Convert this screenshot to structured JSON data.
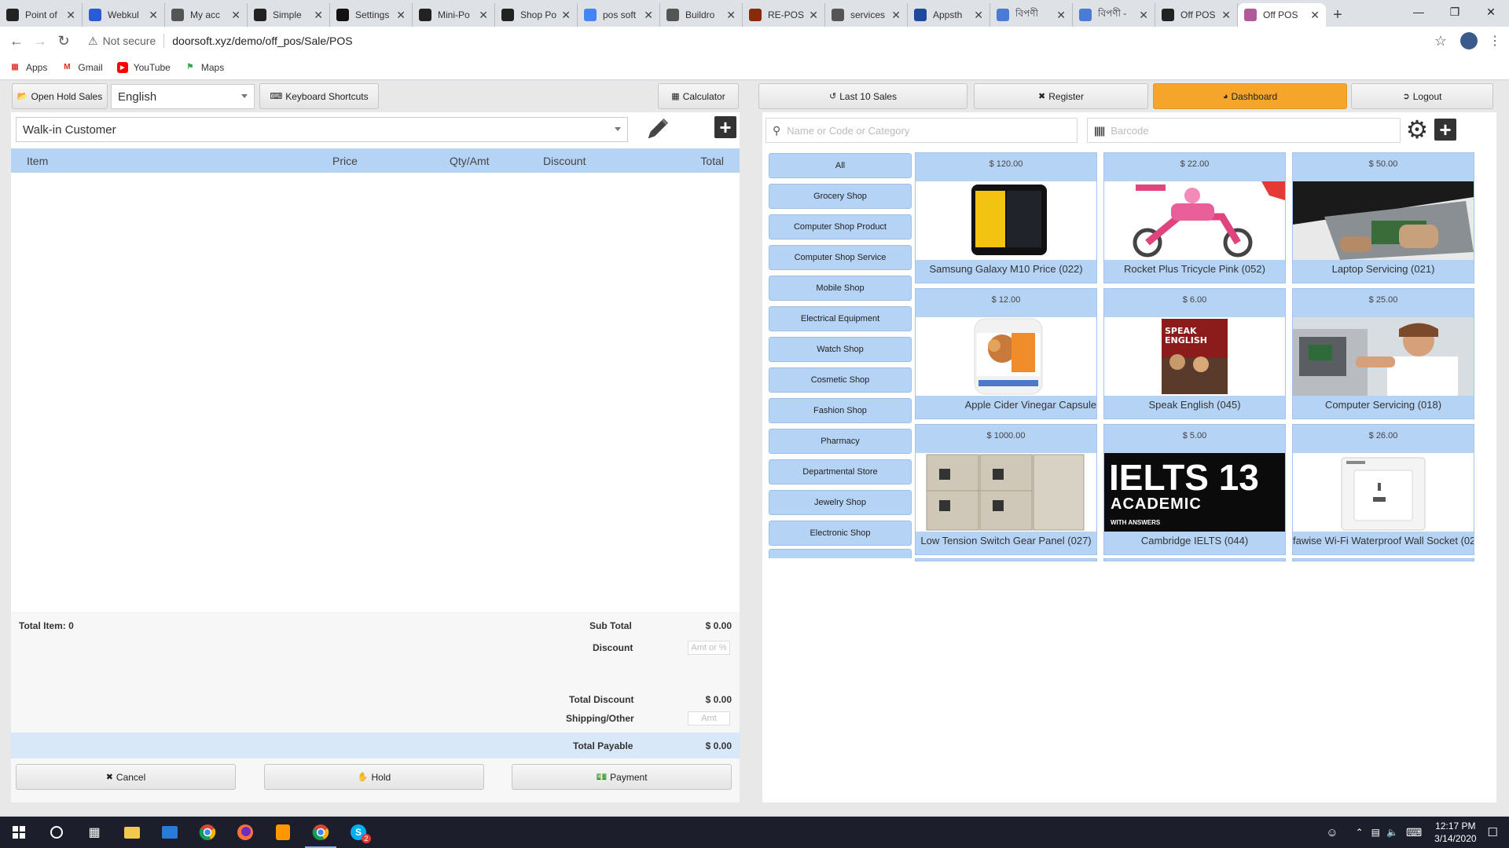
{
  "browser": {
    "tabs": [
      {
        "label": "Point of",
        "color": "#222"
      },
      {
        "label": "Webkul",
        "color": "#2a5bd7"
      },
      {
        "label": "My acc",
        "color": "#555"
      },
      {
        "label": "Simple",
        "color": "#222"
      },
      {
        "label": "Settings",
        "color": "#111"
      },
      {
        "label": "Mini-Po",
        "color": "#222"
      },
      {
        "label": "Shop Po",
        "color": "#222"
      },
      {
        "label": "pos soft",
        "color": "#4285f4"
      },
      {
        "label": "Buildro",
        "color": "#555"
      },
      {
        "label": "RE-POS",
        "color": "#8b2a0b"
      },
      {
        "label": "services",
        "color": "#555"
      },
      {
        "label": "Appsth",
        "color": "#1d4a9c"
      },
      {
        "label": "বিপণী",
        "color": "#4a7bd7"
      },
      {
        "label": "বিপণী -",
        "color": "#4a7bd7"
      },
      {
        "label": "Off POS",
        "color": "#222"
      },
      {
        "label": "Off POS",
        "color": "#b05a9a"
      }
    ],
    "new_tab": "+",
    "not_secure": "Not secure",
    "url": "doorsoft.xyz/demo/off_pos/Sale/POS",
    "bookmarks": [
      {
        "label": "Apps",
        "icon": "apps-grid-icon",
        "color": "#e2453c"
      },
      {
        "label": "Gmail",
        "icon": "gmail-icon",
        "color": "#d93025"
      },
      {
        "label": "YouTube",
        "icon": "youtube-icon",
        "color": "#ff0000"
      },
      {
        "label": "Maps",
        "icon": "maps-icon",
        "color": "#34a853"
      }
    ]
  },
  "pos": {
    "open_hold_sales": "Open Hold Sales",
    "language": "English",
    "keyboard_shortcuts": "Keyboard Shortcuts",
    "calculator": "Calculator",
    "customer": "Walk-in Customer",
    "cart_columns": [
      "Item",
      "Price",
      "Qty/Amt",
      "Discount",
      "Total"
    ],
    "total_item_label": "Total Item: 0",
    "sub_total_label": "Sub Total",
    "sub_total": "$ 0.00",
    "discount_label": "Discount",
    "discount_placeholder": "Amt or %",
    "total_discount_label": "Total Discount",
    "total_discount": "$ 0.00",
    "shipping_label": "Shipping/Other",
    "shipping_placeholder": "Amt",
    "total_payable_label": "Total Payable",
    "total_payable": "$ 0.00",
    "cancel": "Cancel",
    "hold": "Hold",
    "payment": "Payment",
    "last_10_sales": "Last 10 Sales",
    "register": "Register",
    "dashboard": "Dashboard",
    "logout": "Logout",
    "search_placeholder": "Name or Code or Category",
    "barcode_placeholder": "Barcode",
    "categories": [
      "All",
      "Grocery Shop",
      "Computer Shop Product",
      "Computer Shop Service",
      "Mobile Shop",
      "Electrical Equipment",
      "Watch Shop",
      "Cosmetic Shop",
      "Fashion Shop",
      "Pharmacy",
      "Departmental Store",
      "Jewelry Shop",
      "Electronic Shop"
    ],
    "products": [
      {
        "price": "$ 120.00",
        "name": "Samsung Galaxy M10 Price (022)"
      },
      {
        "price": "$ 22.00",
        "name": "Rocket Plus Tricycle Pink (052)"
      },
      {
        "price": "$ 50.00",
        "name": "Laptop Servicing (021)"
      },
      {
        "price": "$ 12.00",
        "name": "Apple Cider Vinegar Capsule"
      },
      {
        "price": "$ 6.00",
        "name": "Speak English (045)"
      },
      {
        "price": "$ 25.00",
        "name": "Computer Servicing (018)"
      },
      {
        "price": "$ 1000.00",
        "name": "Low Tension Switch Gear Panel (027)"
      },
      {
        "price": "$ 5.00",
        "name": "Cambridge IELTS (044)"
      },
      {
        "price": "$ 26.00",
        "name": "fawise Wi-Fi Waterproof Wall Socket (02"
      }
    ],
    "ielts_text": "IELTS 13",
    "ielts_sub": "ACADEMIC",
    "ielts_small": "WITH ANSWERS",
    "speak_text": "SPEAK ENGLISH",
    "colors": {
      "accent": "#f4a52a",
      "header_blue": "#b5d3f5"
    }
  },
  "taskbar": {
    "time": "12:17 PM",
    "date": "3/14/2020",
    "badge": "2"
  }
}
